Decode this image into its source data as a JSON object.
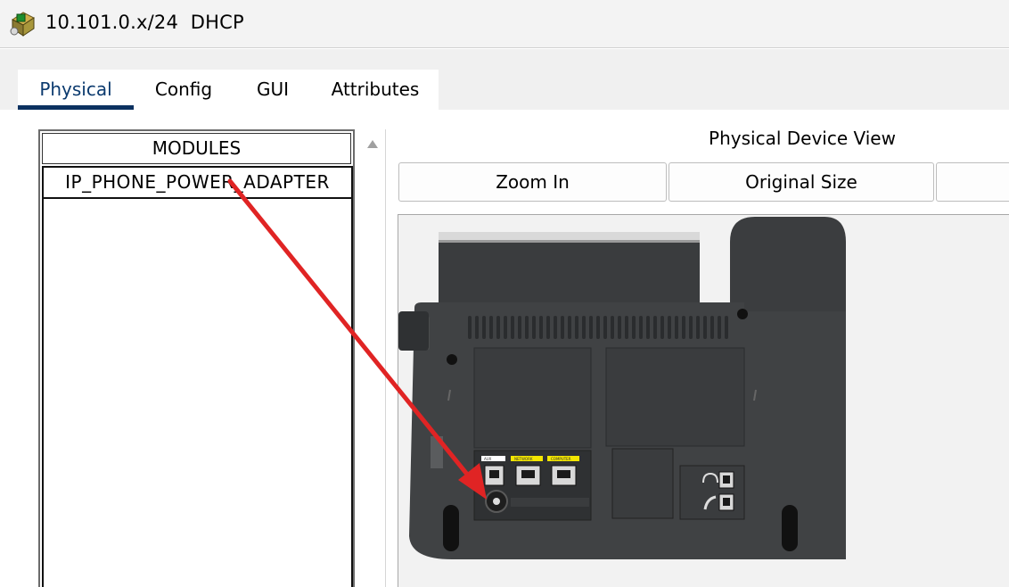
{
  "window": {
    "title": "10.101.0.x/24  DHCP",
    "icon": "router-device-icon"
  },
  "tabs": [
    {
      "label": "Physical",
      "active": true
    },
    {
      "label": "Config",
      "active": false
    },
    {
      "label": "GUI",
      "active": false
    },
    {
      "label": "Attributes",
      "active": false
    }
  ],
  "modules": {
    "header": "MODULES",
    "items": [
      "IP_PHONE_POWER_ADAPTER"
    ]
  },
  "device_view": {
    "title": "Physical Device View",
    "buttons": [
      "Zoom In",
      "Original Size",
      ""
    ]
  },
  "colors": {
    "tab_active_underline": "#0c3160",
    "annotation_arrow": "#e02424",
    "phone_body": "#3f4143"
  },
  "annotation": {
    "type": "arrow",
    "from": "modules.items.0",
    "to": "power-adapter-port"
  }
}
